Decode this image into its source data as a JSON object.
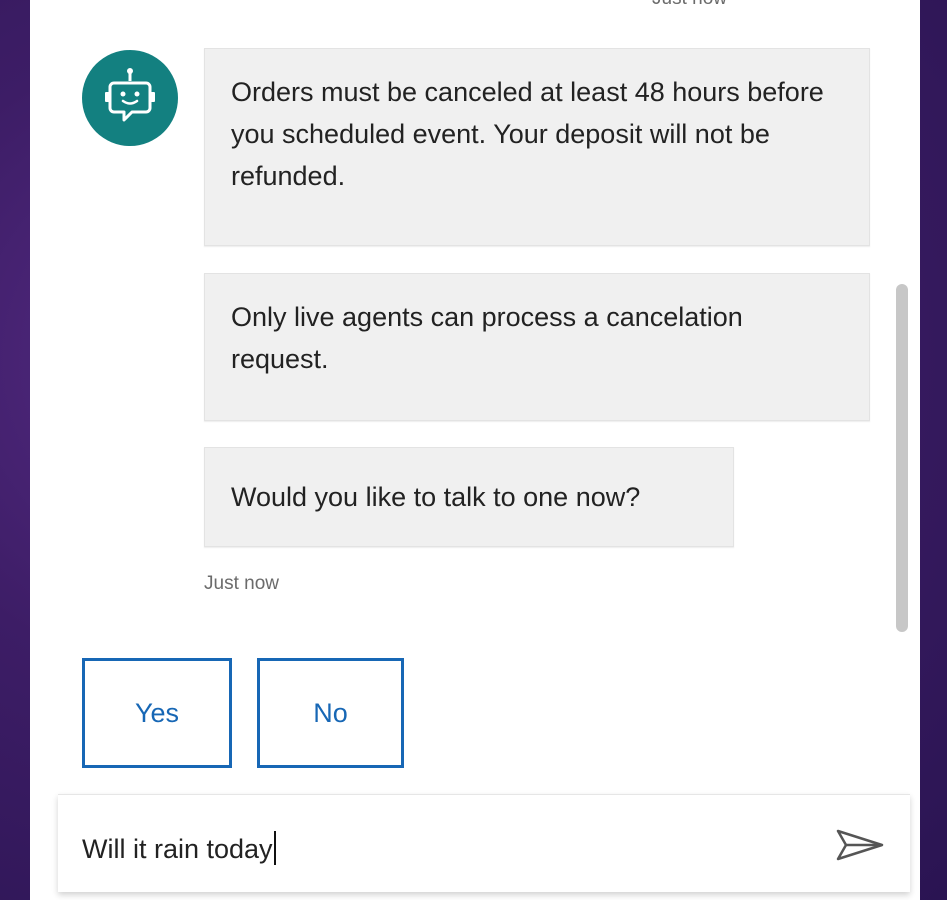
{
  "chat": {
    "top_timestamp": "Just now",
    "messages": [
      {
        "text": "Orders must be canceled at least 48 hours before you scheduled event.  Your deposit will not be refunded."
      },
      {
        "text": "Only live agents can process a cancelation request."
      },
      {
        "text": "Would you like to talk to one now?"
      }
    ],
    "timestamp": "Just now",
    "suggested_actions": [
      {
        "label": "Yes"
      },
      {
        "label": "No"
      }
    ]
  },
  "input": {
    "value": "Will it rain today"
  },
  "icons": {
    "avatar": "bot-icon",
    "send": "send-icon"
  },
  "colors": {
    "avatar_bg": "#138080",
    "accent": "#1767b5",
    "bubble_bg": "#f0f0f0"
  }
}
